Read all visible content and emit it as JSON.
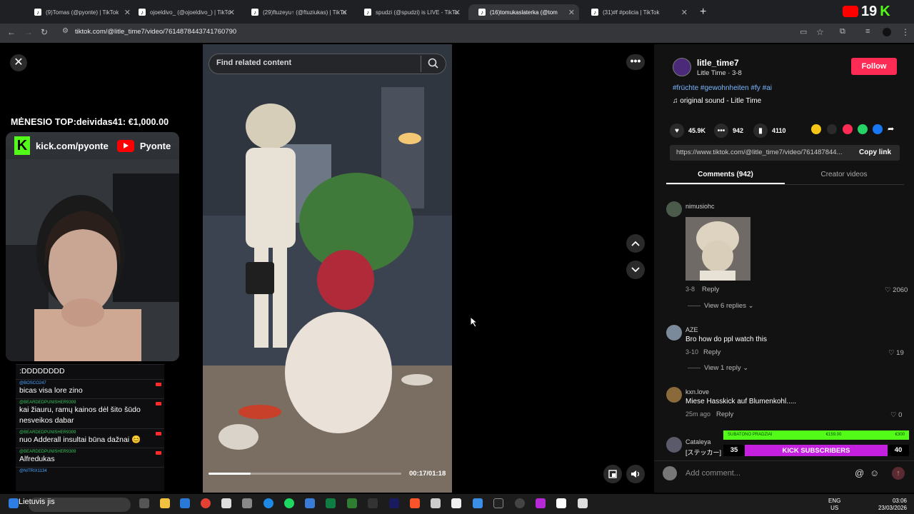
{
  "browser": {
    "tabs": [
      {
        "title": "(9)Tomas (@pyonte) | TikTok",
        "active": false
      },
      {
        "title": "ojoeldivo_ (@ojoeldivo_) | TikTo",
        "active": false
      },
      {
        "title": "(29)ftuzeyu↑ (@ftuziukas) | TikTo",
        "active": false
      },
      {
        "title": "spudzi (@spudzi) is LIVE - TikTo",
        "active": false
      },
      {
        "title": "(16)tomukaslaterka (@tom",
        "active": true
      },
      {
        "title": "(31)#f #policia | TikTok",
        "active": false
      }
    ],
    "new_tab": "+",
    "url": "tiktok.com/@litle_time7/video/7614878443741760790",
    "overlay_number": "19"
  },
  "stream": {
    "top_donor": "MĖNESIO TOP:deividas41: €1,000.00",
    "kick_url": "kick.com/pyonte",
    "youtube_name": "Pyonte",
    "chat": [
      {
        "user": "",
        "text": ":DDDDDDDD",
        "user_color": "blue"
      },
      {
        "user": "@BOSCO247",
        "text": "bicas visa lore zino",
        "user_color": "blue"
      },
      {
        "user": "@BEARDEDPUNISHER9309",
        "text": "kai žiauru, ramų kainos dėl šito šūdo nesveikos dabar",
        "user_color": "green"
      },
      {
        "user": "@BEARDEDPUNISHER9309",
        "text": "nuo Adderall insultai būna dažnai 😊",
        "user_color": "green"
      },
      {
        "user": "@BEARDEDPUNISHER9309",
        "text": "Alfredukas",
        "user_color": "green"
      },
      {
        "user": "@NITRIX1134",
        "text": "",
        "user_color": "blue"
      }
    ],
    "taskbar_label": "Lietuvis jis"
  },
  "video": {
    "search_placeholder": "Find related content",
    "time": "00:17/01:18",
    "progress": 0.22
  },
  "post": {
    "author": "litle_time7",
    "author_sub": "Litle Time · 3-8",
    "follow_label": "Follow",
    "hashtags": "#früchte #gewohnheiten #fy #ai",
    "sound": "original sound - Litle Time",
    "likes": "45.9K",
    "comments": "942",
    "saves": "4110",
    "link": "https://www.tiktok.com/@litle_time7/video/761487844...",
    "copy_link_label": "Copy link",
    "tab_comments": "Comments (942)",
    "tab_creator": "Creator videos",
    "comment_list": [
      {
        "user": "nimusiohc",
        "text": "",
        "meta": "3-8",
        "reply": "Reply",
        "likes": "2060",
        "views": "View 6 replies"
      },
      {
        "user": "AZE",
        "text": "Bro how do ppl watch this",
        "meta": "3-10",
        "reply": "Reply",
        "likes": "19",
        "views": "View 1 reply"
      },
      {
        "user": "kxn.love",
        "text": "Miese Hasskick auf Blumenkohl.....",
        "meta": "25m ago",
        "reply": "Reply",
        "likes": "0",
        "views": ""
      },
      {
        "user": "Cataleya",
        "text": "[ステッカー]",
        "meta": "",
        "reply": "",
        "likes": "",
        "views": ""
      }
    ],
    "add_comment_placeholder": "Add comment..."
  },
  "sub_goal": {
    "top_left": "SUBATONO PRADZIAI",
    "top_mid": "€159.00",
    "top_right": "€300",
    "count_left": "35",
    "title": "KICK SUBSCRIBERS",
    "count_right": "40"
  },
  "tray": {
    "lang1": "ENG",
    "lang2": "US",
    "time": "03:06",
    "date": "23/03/2026"
  },
  "colors": {
    "follow": "#fe2c55",
    "kick": "#53fc18",
    "hashtag": "#7ab6ff"
  }
}
